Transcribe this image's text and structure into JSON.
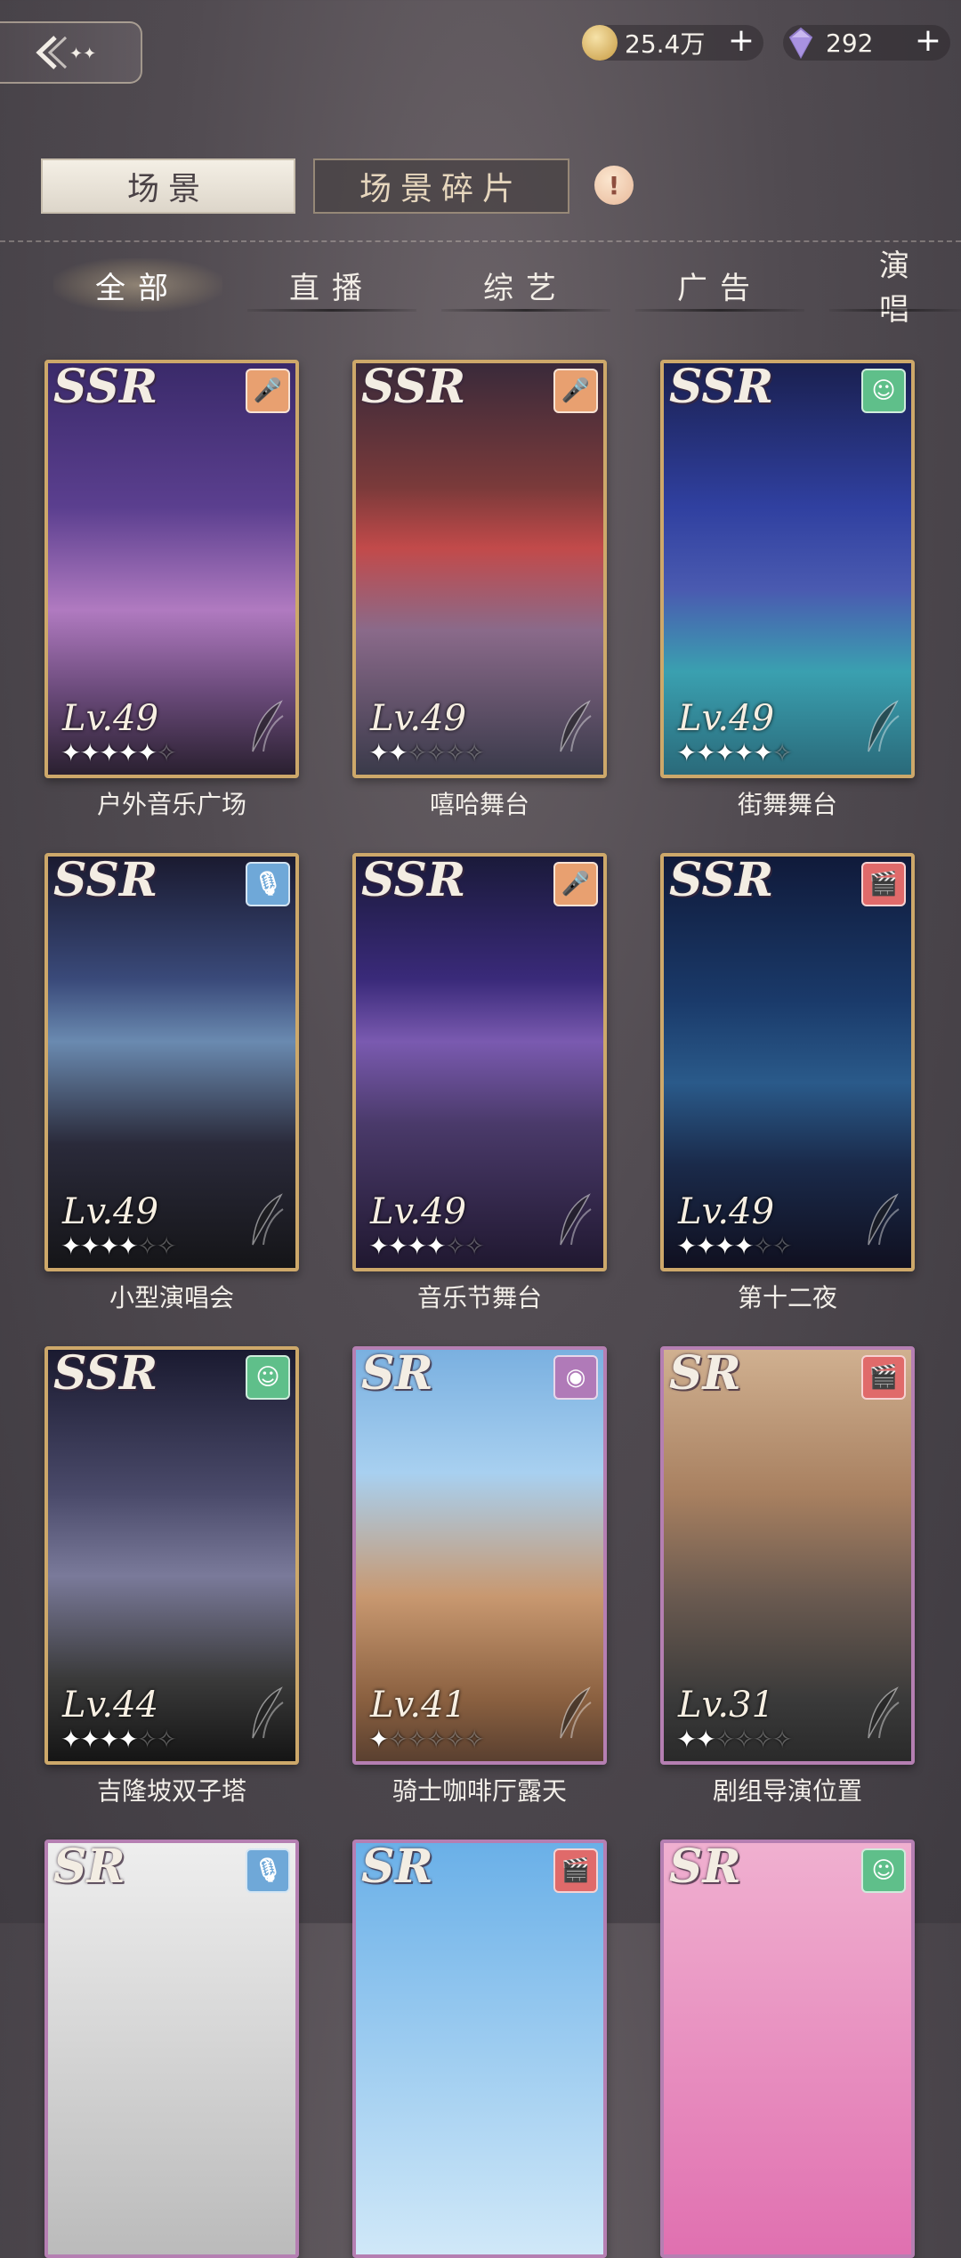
{
  "header": {
    "back_label": "back",
    "coins": "25.4万",
    "gems": "292",
    "plus": "+"
  },
  "main_tabs": [
    {
      "label": "场景"
    },
    {
      "label": "场景碎片"
    }
  ],
  "info_label": "!",
  "categories": [
    "全部",
    "直播",
    "综艺",
    "广告",
    "演唱"
  ],
  "cards": [
    {
      "name": "户外音乐广场",
      "rarity": "SSR",
      "level": "Lv.49",
      "stars": 5,
      "badge_icon": "microphone-icon",
      "badge_color": "#e8a070"
    },
    {
      "name": "嘻哈舞台",
      "rarity": "SSR",
      "level": "Lv.49",
      "stars": 2,
      "badge_icon": "microphone-icon",
      "badge_color": "#e8a070"
    },
    {
      "name": "街舞舞台",
      "rarity": "SSR",
      "level": "Lv.49",
      "stars": 5,
      "badge_icon": "smile-icon",
      "badge_color": "#5fbf8a"
    },
    {
      "name": "小型演唱会",
      "rarity": "SSR",
      "level": "Lv.49",
      "stars": 4,
      "badge_icon": "mic-stand-icon",
      "badge_color": "#6fa8d8"
    },
    {
      "name": "音乐节舞台",
      "rarity": "SSR",
      "level": "Lv.49",
      "stars": 4,
      "badge_icon": "microphone-icon",
      "badge_color": "#e8a070"
    },
    {
      "name": "第十二夜",
      "rarity": "SSR",
      "level": "Lv.49",
      "stars": 4,
      "badge_icon": "clapper-icon",
      "badge_color": "#e06a6a"
    },
    {
      "name": "吉隆坡双子塔",
      "rarity": "SSR",
      "level": "Lv.44",
      "stars": 4,
      "badge_icon": "smile-icon",
      "badge_color": "#5fbf8a"
    },
    {
      "name": "骑士咖啡厅露天",
      "rarity": "SR",
      "level": "Lv.41",
      "stars": 1,
      "badge_icon": "camera-icon",
      "badge_color": "#b07ab8"
    },
    {
      "name": "剧组导演位置",
      "rarity": "SR",
      "level": "Lv.31",
      "stars": 2,
      "badge_icon": "clapper-icon",
      "badge_color": "#e06a6a"
    },
    {
      "name": "",
      "rarity": "SR",
      "level": "",
      "stars": 0,
      "badge_icon": "mic-stand-icon",
      "badge_color": "#6fa8d8"
    },
    {
      "name": "",
      "rarity": "SR",
      "level": "",
      "stars": 0,
      "badge_icon": "clapper-icon",
      "badge_color": "#e06a6a"
    },
    {
      "name": "",
      "rarity": "SR",
      "level": "",
      "stars": 0,
      "badge_icon": "smile-icon",
      "badge_color": "#5fbf8a"
    }
  ]
}
